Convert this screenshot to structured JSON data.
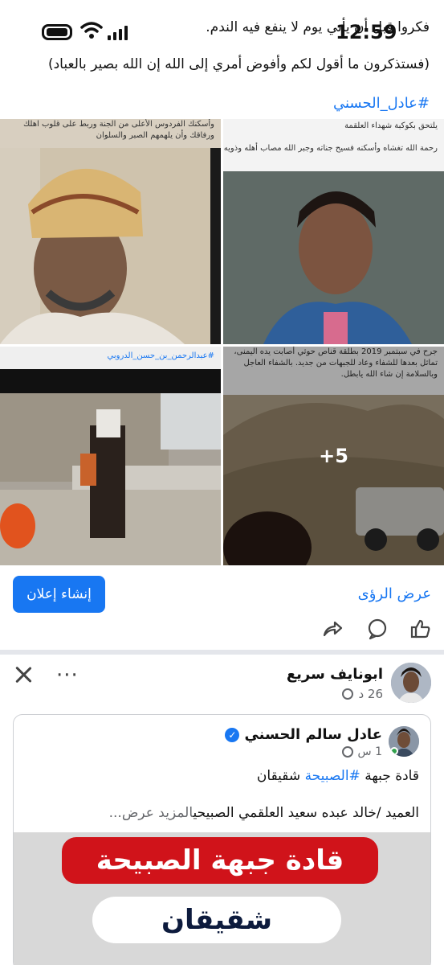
{
  "status_bar": {
    "time": "12:59"
  },
  "post1": {
    "text_line1": "فكروا قبل أن يأتي يوم لا ينفع فيه الندم.",
    "text_line2": "(فستذكرون ما أقول لكم وأفوض أمري إلى الله إن الله بصير بالعباد)",
    "hashtag": "#عادل_الحسني",
    "photos": [
      {
        "caption_top": "وأسكنك الفردوس الأعلى من الجنة وربط على قلوب اهلك ورفاقك وأن يلهمهم الصبر والسلوان"
      },
      {
        "caption_top": "يلتحق بكوكبة شهداء العلقمة",
        "caption_2": "رحمة الله تغشاه وأسكنه فسيح جناته وجبر الله مصاب أهله وذويه"
      },
      {
        "caption_link": "#عبدالرحمن_بن_حسن_الدروبي"
      },
      {
        "caption_top": "جرح في سبتمبر 2019 بطلقة قناص حوثي أصابت يده اليمنى، تماثل بعدها للشفاء وعاد للجبهات من جديد. بالشفاء العاجل وبالسلامة إن شاء الله يابطل.",
        "more_count": "+5"
      }
    ],
    "create_ad_label": "إنشاء إعلان",
    "view_insights_label": "عرض الرؤى"
  },
  "post2": {
    "author": "ابونايف سريع",
    "time": "26 د",
    "shared": {
      "author": "عادل سالم الحسني",
      "time": "1 س",
      "text_prefix": "قادة جبهة ",
      "text_tag": "#الصبيحة",
      "text_suffix": " شقيقان",
      "text2": "العميد /خالد عبده سعيد العلقمي الصبيحي",
      "see_more": "المزيد عرض...",
      "banner_line1": "قادة جبهة الصبيحة",
      "banner_line2": "شقيقان"
    }
  },
  "colors": {
    "accent": "#1877f2",
    "banner_red": "#d0131a"
  },
  "icons": [
    "battery-icon",
    "wifi-icon",
    "signal-icon",
    "like-icon",
    "comment-icon",
    "share-icon",
    "close-icon",
    "more-icon",
    "globe-icon",
    "verified-icon"
  ]
}
